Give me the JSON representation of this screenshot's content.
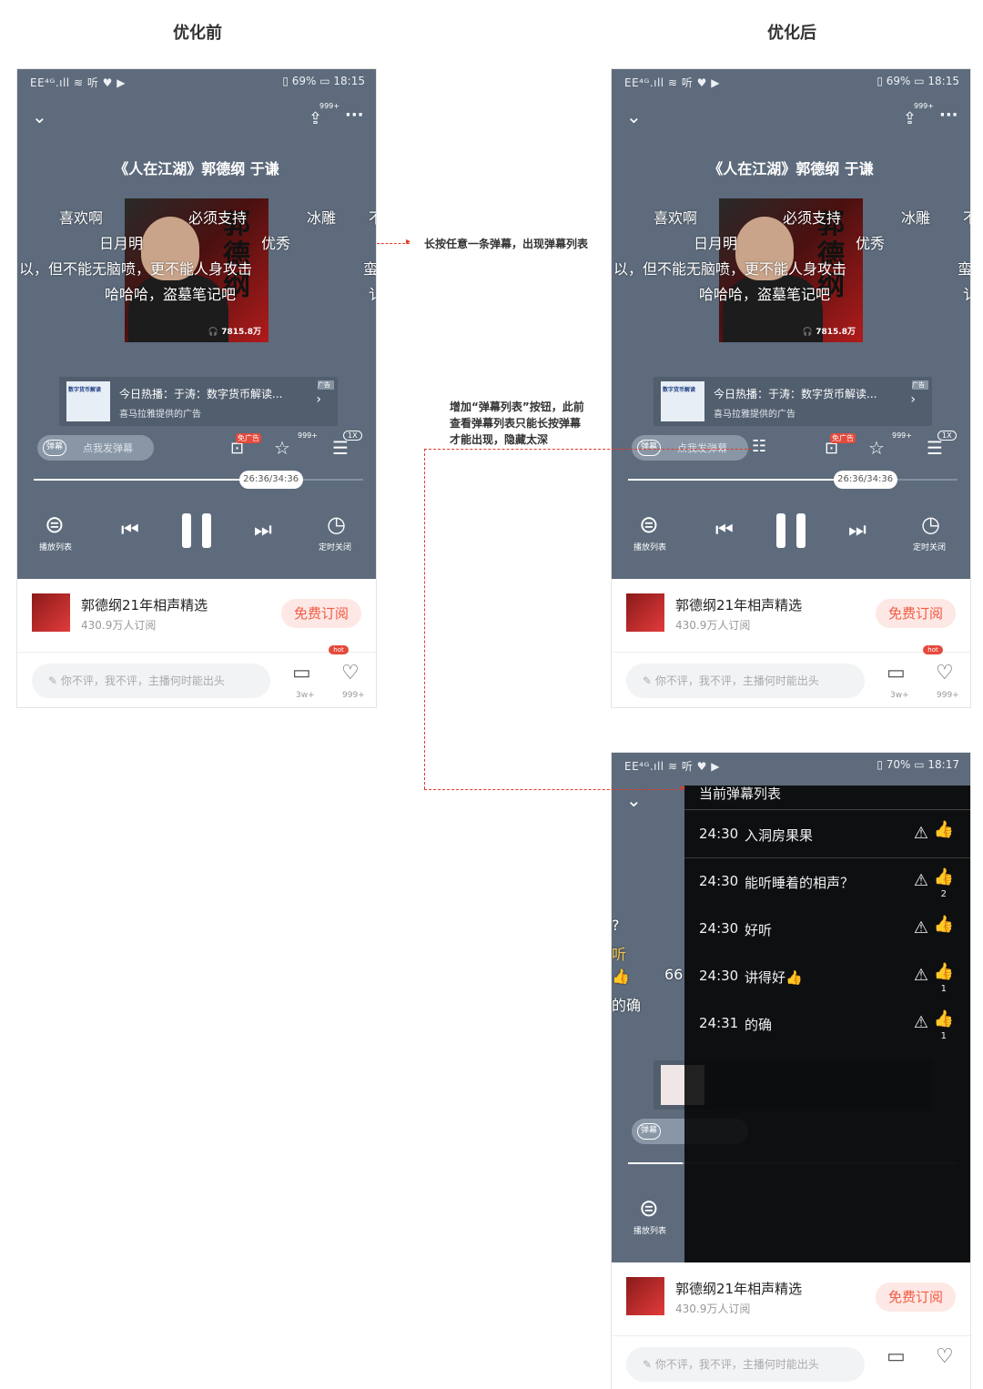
{
  "headers": {
    "before": "优化前",
    "after": "优化后"
  },
  "notes": {
    "long_press": "长按任意一条弹幕，出现弹幕列表",
    "add_button": [
      "增加“弹幕列表”按钮，此前",
      "查看弹幕列表只能长按弹幕",
      "才能出现，隐藏太深"
    ]
  },
  "status": {
    "left": "EE⁴ᴳ.ıll ≋ 听 ♥ ▶",
    "right_1815": "▯ 69%  ▭  18:15",
    "right_1817": "▯ 70%  ▭  18:17"
  },
  "player": {
    "title": "《人在江湖》郭德纲 于谦",
    "share_count": "999+",
    "cover_text": "郭德纲",
    "cover_plays": "🎧 7815.8万",
    "danmaku": {
      "row1a": "喜欢啊",
      "row1b": "必须支持",
      "row1c": "冰雕",
      "row1d": "不",
      "row2a": "日月明",
      "row2b": "优秀",
      "row3a": "以，但不能无脑喷，更不能人身攻击",
      "row3b": "蛮",
      "row4a": "哈哈哈，盗墓笔记吧",
      "row4b": "讠"
    },
    "ad": {
      "thumb_text": "数字货币解读",
      "title": "今日热播：于涛：数字货币解读...",
      "sub": "喜马拉雅提供的广告",
      "tag": "广告"
    },
    "dm_switch": "弹幕",
    "dm_hint": "点我发弹幕",
    "free_ad": "免广告",
    "call_count": "999+",
    "speed": "1X",
    "time": "26:36/34:36",
    "progress": 0.72,
    "playlist_label": "播放列表",
    "timer_label": "定时关闭"
  },
  "album": {
    "name": "郭德纲21年相声精选",
    "subs": "430.9万人订阅",
    "subscribe": "免费订阅"
  },
  "comment": {
    "placeholder": "你不评，我不评，主播何时能出头",
    "hot": "hot",
    "msg_count": "3w+",
    "like_count": "999+"
  },
  "dm_list": {
    "title": "当前弹幕列表",
    "items": [
      {
        "time": "24:30",
        "text": "入洞房果果",
        "likes": ""
      },
      {
        "time": "24:30",
        "text": "能听睡着的相声？",
        "likes": "2"
      },
      {
        "time": "24:30",
        "text": "好听",
        "likes": ""
      },
      {
        "time": "24:30",
        "text": "讲得好👍",
        "likes": "1"
      },
      {
        "time": "24:31",
        "text": "的确",
        "likes": "1"
      }
    ],
    "left_peek": [
      "?",
      "听",
      "👍",
      "的确"
    ],
    "peek_66": "66"
  }
}
